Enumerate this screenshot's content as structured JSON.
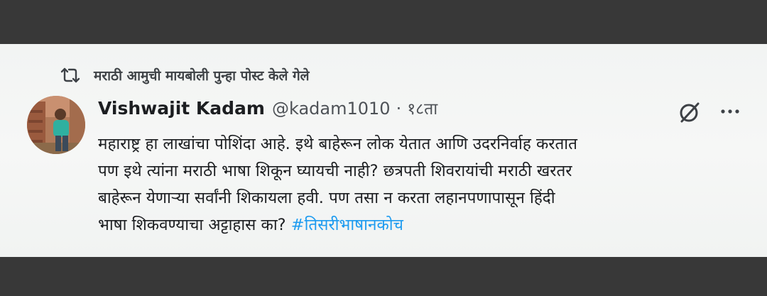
{
  "repost": {
    "icon": "repost-icon",
    "label": "मराठी आमुची मायबोली पुन्हा पोस्ट केले गेले"
  },
  "author": {
    "avatar": "avatar",
    "display_name": "Vishwajit Kadam",
    "handle": "@kadam1010",
    "separator": "·",
    "time": "१८ता"
  },
  "actions": {
    "grok_icon": "grok-icon",
    "more_icon": "more-icon"
  },
  "tweet": {
    "lines": [
      "महाराष्ट्र हा लाखांचा पोशिंदा आहे. इथे बाहेरून लोक येतात आणि उदरनिर्वाह करतात",
      "पण इथे त्यांना मराठी भाषा शिकून घ्यायची नाही? छत्रपती शिवरायांची मराठी खरतर",
      "बाहेरून येणाऱ्या सर्वांनी शिकायला हवी. पण तसा न करता लहानपणापासून हिंदी",
      "भाषा शिकवण्याचा अट्टाहास का? "
    ],
    "hashtag": "#तिसरीभाषानकोच"
  },
  "colors": {
    "hashtag": "#1d9bf0",
    "text": "#1c1e21",
    "muted": "#4e5257",
    "band": "#383838"
  }
}
